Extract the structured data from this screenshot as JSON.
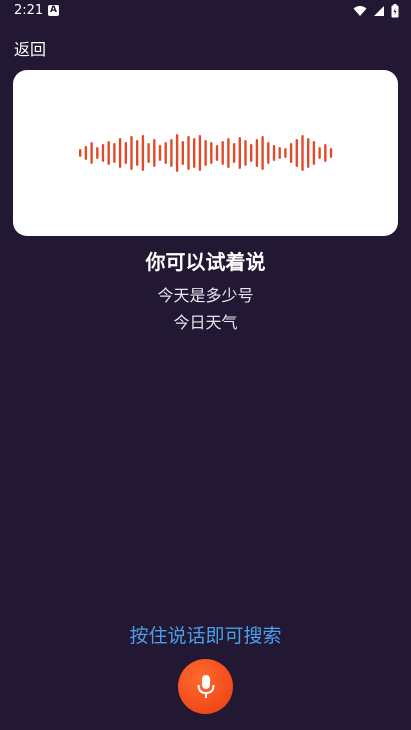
{
  "status_bar": {
    "time": "2:21",
    "notification_icon": "a-letter-icon",
    "icons": [
      "wifi-icon",
      "signal-icon",
      "battery-icon"
    ]
  },
  "header": {
    "back_label": "返回"
  },
  "waveform": {
    "color": "#e24a2c",
    "levels": [
      0.2,
      0.35,
      0.55,
      0.3,
      0.45,
      0.6,
      0.5,
      0.75,
      0.55,
      0.85,
      0.65,
      0.9,
      0.5,
      0.7,
      0.4,
      0.55,
      0.7,
      0.95,
      0.6,
      0.85,
      0.75,
      0.9,
      0.65,
      0.55,
      0.4,
      0.6,
      0.75,
      0.5,
      0.8,
      0.65,
      0.45,
      0.7,
      0.85,
      0.55,
      0.4,
      0.3,
      0.25,
      0.5,
      0.7,
      0.9,
      0.75,
      0.6,
      0.3,
      0.45,
      0.25
    ]
  },
  "main": {
    "title": "你可以试着说",
    "suggestions": [
      "今天是多少号",
      "今日天气"
    ],
    "press_hint": "按住说话即可搜索"
  },
  "colors": {
    "background": "#231833",
    "accent_text": "#4a9eea",
    "mic_button": "#f04a1a"
  }
}
